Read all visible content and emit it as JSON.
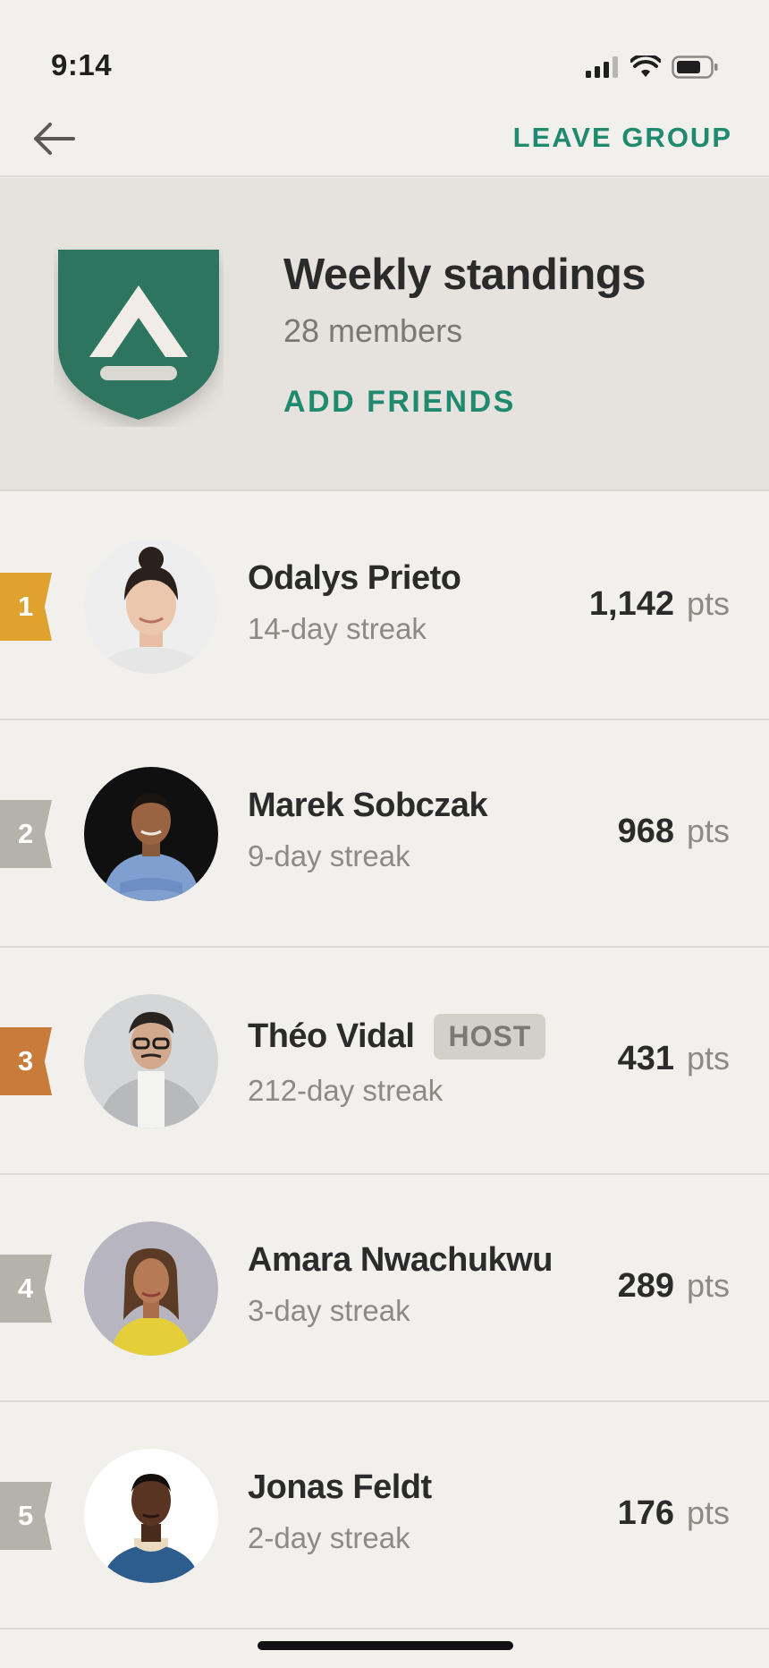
{
  "status_bar": {
    "time": "9:14"
  },
  "nav": {
    "leave_label": "LEAVE GROUP"
  },
  "group": {
    "title": "Weekly standings",
    "members": "28 members",
    "add_friends_label": "ADD FRIENDS",
    "badge_color": "#2e7560"
  },
  "colors": {
    "accent": "#1f8a6e",
    "rank_gold": "#e0a22e",
    "rank_bronze": "#c97b3a",
    "rank_neutral": "#b5b2ab"
  },
  "rows": [
    {
      "rank": "1",
      "name": "Odalys Prieto",
      "streak": "14-day streak",
      "points": "1,142",
      "unit": "pts"
    },
    {
      "rank": "2",
      "name": "Marek Sobczak",
      "streak": "9-day streak",
      "points": "968",
      "unit": "pts"
    },
    {
      "rank": "3",
      "name": "Théo Vidal",
      "badge": "HOST",
      "streak": "212-day streak",
      "points": "431",
      "unit": "pts"
    },
    {
      "rank": "4",
      "name": "Amara Nwachukwu",
      "streak": "3-day streak",
      "points": "289",
      "unit": "pts"
    },
    {
      "rank": "5",
      "name": "Jonas Feldt",
      "streak": "2-day streak",
      "points": "176",
      "unit": "pts"
    }
  ]
}
